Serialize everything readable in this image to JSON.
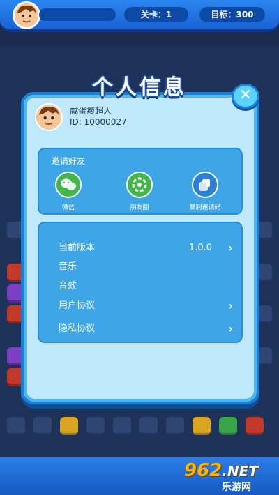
{
  "hud": {
    "level": "关卡：1",
    "target": "目标：300"
  },
  "dialog": {
    "title": "个人信息",
    "close_icon": "close-icon",
    "profile": {
      "name": "咸蛋瘦超人",
      "id": "ID: 10000027"
    },
    "invite": {
      "title": "邀请好友",
      "buttons": [
        {
          "label": "微信",
          "icon": "wechat-icon",
          "color": "#42b64a"
        },
        {
          "label": "朋友圈",
          "icon": "moments-icon",
          "color": "#42b64a"
        },
        {
          "label": "复制邀请码",
          "icon": "copy-icon",
          "color": "#2a7fd8"
        }
      ]
    },
    "settings": [
      {
        "label": "当前版本",
        "value": "1.0.0",
        "chevron": true
      },
      {
        "label": "音乐",
        "value": "",
        "chevron": false
      },
      {
        "label": "音效",
        "value": "",
        "chevron": false
      },
      {
        "label": "用户协议",
        "value": "",
        "chevron": true
      },
      {
        "label": "隐私协议",
        "value": "",
        "chevron": true
      }
    ]
  },
  "watermark": {
    "logo": "962",
    "net": ".NET",
    "sub": "乐游网"
  }
}
